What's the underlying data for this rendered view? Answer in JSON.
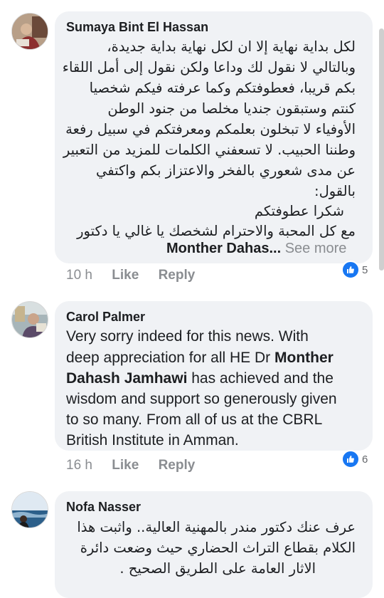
{
  "comments": [
    {
      "author": "Sumaya Bint El Hassan",
      "lines": [
        "لكل بداية نهاية إلا ان لكل نهاية بداية جديدة،",
        "وبالتالي لا نقول لك وداعا ولكن نقول إلى أمل اللقاء",
        "بكم قريبا، فعطوفتكم وكما عرفته فيكم شخصيا",
        "كنتم وستبقون جنديا مخلصا من جنود الوطن",
        "الأوفياء لا تبخلون بعلمكم ومعرفتكم في سبيل رفعة",
        "وطننا الحبيب. لا تسعفني الكلمات للمزيد من التعبير",
        "عن مدى شعوري بالفخر والاعتزاز بكم واكتفي",
        "بالقول:",
        "شكرا عطوفتكم",
        "مع كل المحبة والاحترام لشخصك يا غالي يا دكتور"
      ],
      "tag_name": "Monther Dahas...",
      "see_more": "See more",
      "time": "10 h",
      "like_label": "Like",
      "reply_label": "Reply",
      "reaction_count": "5"
    },
    {
      "author": "Carol Palmer",
      "lines": [
        {
          "a": "Very sorry indeed for this news. With",
          "b": ""
        },
        {
          "a": "deep appreciation for all HE Dr ",
          "b": "Monther"
        },
        {
          "a": "",
          "b": "Dahash Jamhawi",
          "c": " has achieved and the"
        },
        {
          "a": "wisdom and support so generously given",
          "b": ""
        },
        {
          "a": "to so many. From all of us at the CBRL",
          "b": ""
        },
        {
          "a": "British Institute in Amman.",
          "b": ""
        }
      ],
      "time": "16 h",
      "like_label": "Like",
      "reply_label": "Reply",
      "reaction_count": "6"
    },
    {
      "author": "Nofa Nasser",
      "lines": [
        "عرف عنك دكتور مندر بالمهنية  العالية.. واثبت هذا",
        "الكلام بقطاع التراث الحضاري حيث وضعت دائرة",
        "الاثار العامة  على الطريق الصحيح ."
      ]
    }
  ],
  "colors": {
    "bubble": "#f0f2f5",
    "meta": "#8a8d91",
    "like_blue": "#1877f2"
  },
  "icons": [
    "avatar-photo",
    "thumbs-up-icon"
  ]
}
